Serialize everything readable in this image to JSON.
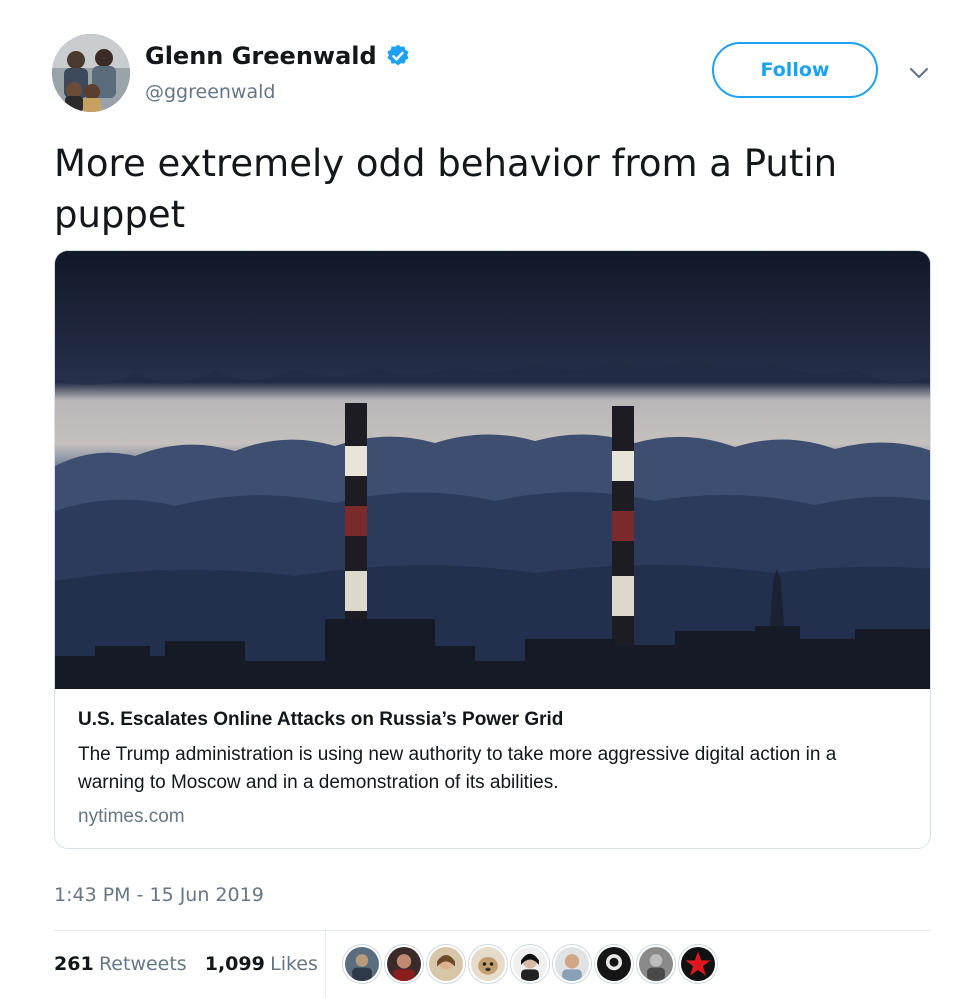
{
  "user": {
    "display_name": "Glenn Greenwald",
    "handle": "@ggreenwald",
    "verified": true
  },
  "actions": {
    "follow_label": "Follow"
  },
  "tweet": {
    "text": "More extremely odd behavior from a Putin puppet",
    "timestamp": "1:43 PM - 15 Jun 2019"
  },
  "card": {
    "title": "U.S. Escalates Online Attacks on Russia’s Power Grid",
    "description": "The Trump administration is using new authority to take more aggressive digital action in a warning to Moscow and in a demonstration of its abilities.",
    "domain": "nytimes.com"
  },
  "stats": {
    "retweets_count": "261",
    "retweets_label": "Retweets",
    "likes_count": "1,099",
    "likes_label": "Likes"
  },
  "colors": {
    "accent": "#1da1f2",
    "secondary_text": "#657786",
    "primary_text": "#14171a"
  }
}
